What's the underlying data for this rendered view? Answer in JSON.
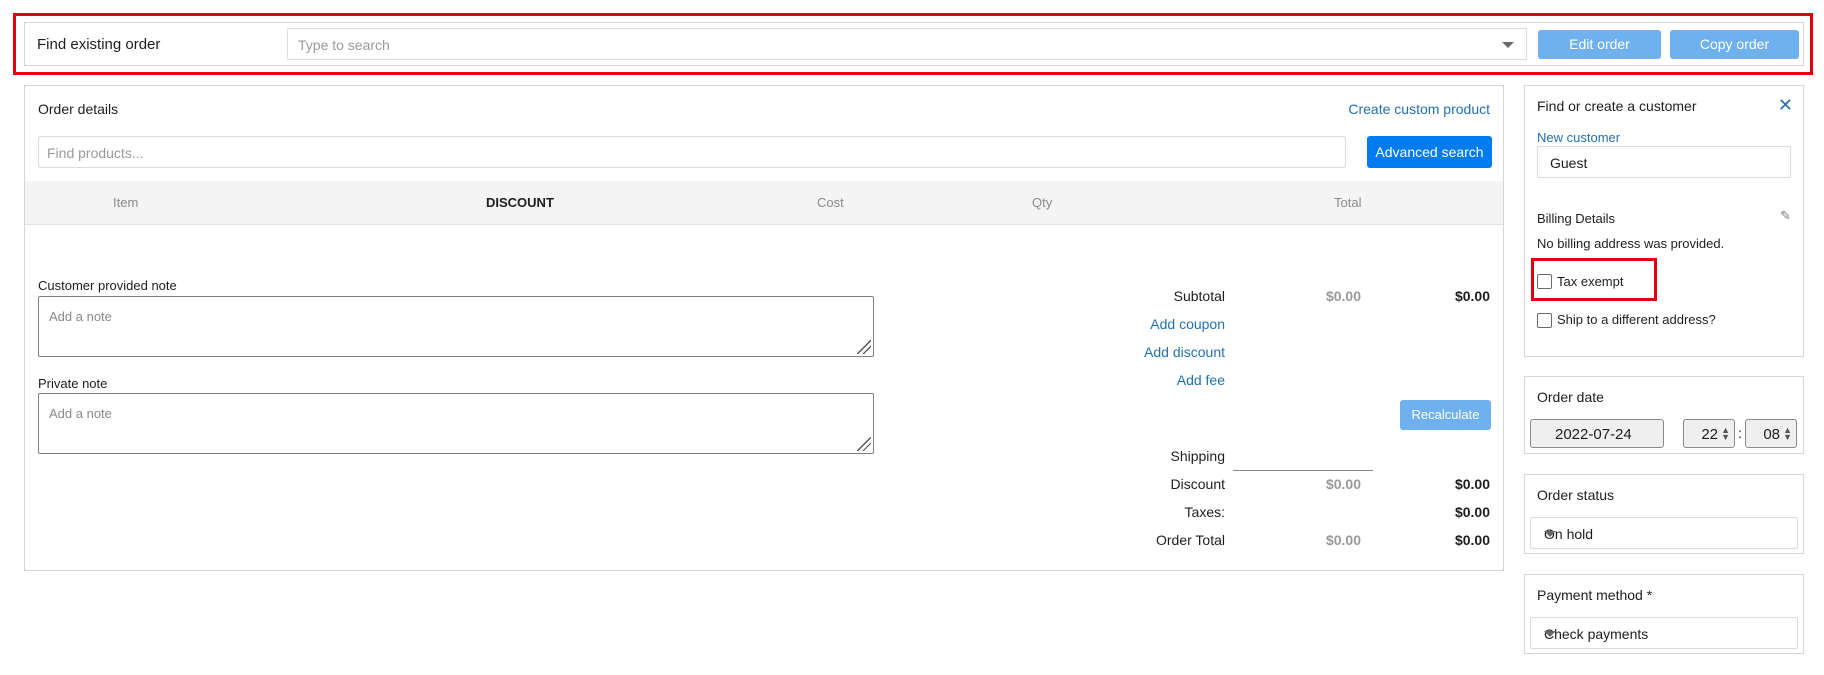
{
  "finder": {
    "label": "Find existing order",
    "search_placeholder": "Type to search",
    "edit_label": "Edit order",
    "copy_label": "Copy order"
  },
  "order": {
    "title": "Order details",
    "create_custom_product": "Create custom product",
    "find_products_placeholder": "Find products...",
    "advanced_search": "Advanced search",
    "columns": {
      "item": "Item",
      "discount": "DISCOUNT",
      "cost": "Cost",
      "qty": "Qty",
      "total": "Total"
    },
    "customer_note_label": "Customer provided note",
    "customer_note_placeholder": "Add a note",
    "private_note_label": "Private note",
    "private_note_placeholder": "Add a note",
    "summary": {
      "subtotal_label": "Subtotal",
      "subtotal_cost": "$0.00",
      "subtotal_total": "$0.00",
      "add_coupon": "Add coupon",
      "add_discount": "Add discount",
      "add_fee": "Add fee",
      "recalculate": "Recalculate",
      "shipping_label": "Shipping",
      "discount_label": "Discount",
      "discount_cost": "$0.00",
      "discount_total": "$0.00",
      "taxes_label": "Taxes:",
      "taxes_total": "$0.00",
      "order_total_label": "Order Total",
      "order_total_cost": "$0.00",
      "order_total_total": "$0.00"
    }
  },
  "customer": {
    "title": "Find or create a customer",
    "new_customer": "New customer",
    "selected": "Guest",
    "billing_title": "Billing Details",
    "no_billing": "No billing address was provided.",
    "tax_exempt_label": "Tax exempt",
    "tax_exempt_checked": false,
    "ship_different_label": "Ship to a different address?",
    "ship_different_checked": false
  },
  "order_date": {
    "title": "Order date",
    "date": "2022-07-24",
    "hour": "22",
    "minute": "08"
  },
  "order_status": {
    "title": "Order status",
    "value": "On hold"
  },
  "payment": {
    "title": "Payment method *",
    "value": "Check payments"
  },
  "colors": {
    "accent": "#007cf0",
    "accent_light": "#6fb1ee",
    "link": "#2271b1",
    "highlight": "#e3000f"
  }
}
